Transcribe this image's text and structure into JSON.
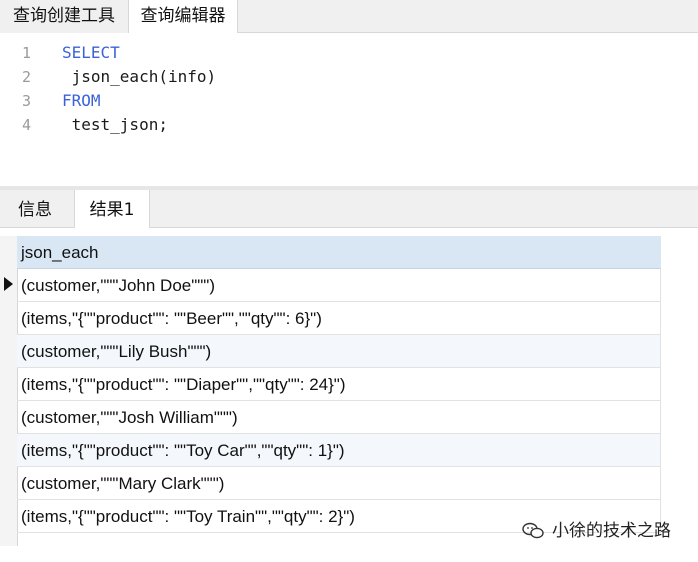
{
  "top_tabs": [
    {
      "label": "查询创建工具"
    },
    {
      "label": "查询编辑器",
      "active": true
    }
  ],
  "editor": {
    "lines": [
      {
        "num": "1",
        "text": "SELECT",
        "keyword": true
      },
      {
        "num": "2",
        "text": " json_each(info)",
        "keyword": false
      },
      {
        "num": "3",
        "text": "FROM",
        "keyword": true
      },
      {
        "num": "4",
        "text": " test_json;",
        "keyword": false
      }
    ]
  },
  "result_tabs": [
    {
      "label": "信息"
    },
    {
      "label": "结果1",
      "active": true
    }
  ],
  "grid": {
    "column": "json_each",
    "current_row": 1,
    "rows": [
      "(customer,\"\"\"John Doe\"\"\")",
      "(items,\"{\"\"product\"\": \"\"Beer\"\",\"\"qty\"\": 6}\")",
      "(customer,\"\"\"Lily Bush\"\"\")",
      "(items,\"{\"\"product\"\": \"\"Diaper\"\",\"\"qty\"\": 24}\")",
      "(customer,\"\"\"Josh William\"\"\")",
      "(items,\"{\"\"product\"\": \"\"Toy Car\"\",\"\"qty\"\": 1}\")",
      "(customer,\"\"\"Mary Clark\"\"\")",
      "(items,\"{\"\"product\"\": \"\"Toy Train\"\",\"\"qty\"\": 2}\")"
    ]
  },
  "watermark": {
    "text": "小徐的技术之路",
    "logo_icon": "wechat-logo-icon"
  },
  "colors": {
    "keyword": "#3b62d8",
    "header_bg": "#d9e7f5",
    "selected_row_bg": "#f4f7fb"
  }
}
